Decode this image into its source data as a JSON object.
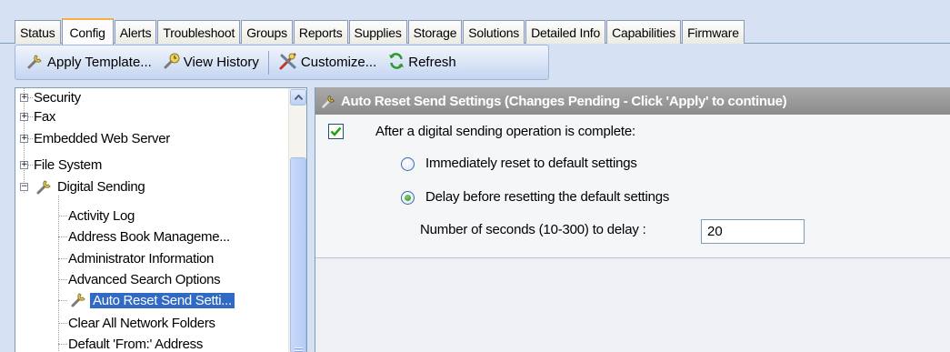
{
  "tabs": [
    "Status",
    "Config",
    "Alerts",
    "Troubleshoot",
    "Groups",
    "Reports",
    "Supplies",
    "Storage",
    "Solutions",
    "Detailed Info",
    "Capabilities",
    "Firmware"
  ],
  "active_tab": "Config",
  "toolbar": {
    "apply_template": "Apply Template...",
    "view_history": "View History",
    "customize": "Customize...",
    "refresh": "Refresh"
  },
  "tree": {
    "security": "Security",
    "fax": "Fax",
    "embedded_web_server": "Embedded Web Server",
    "file_system": "File System",
    "digital_sending": "Digital Sending",
    "activity_log": "Activity Log",
    "address_book": "Address Book  Manageme...",
    "administrator_info": "Administrator Information",
    "advanced_search": "Advanced Search Options",
    "auto_reset": "Auto Reset Send Setti...",
    "clear_network_folders": "Clear All Network Folders",
    "default_from": "Default 'From:' Address"
  },
  "panel": {
    "header": "Auto Reset Send Settings (Changes Pending - Click 'Apply' to continue)",
    "checkbox_label": "After a digital sending operation is complete:",
    "checkbox_checked": true,
    "radio_immediate": "Immediately reset to default settings",
    "radio_delay": "Delay before resetting the default settings",
    "selected_radio": "delay",
    "delay_label": "Number of seconds (10-300) to delay :",
    "delay_value": "20"
  },
  "colors": {
    "selection": "#316ac5",
    "active_tab_accent": "#f5b23a",
    "header_bg": "#999999"
  }
}
